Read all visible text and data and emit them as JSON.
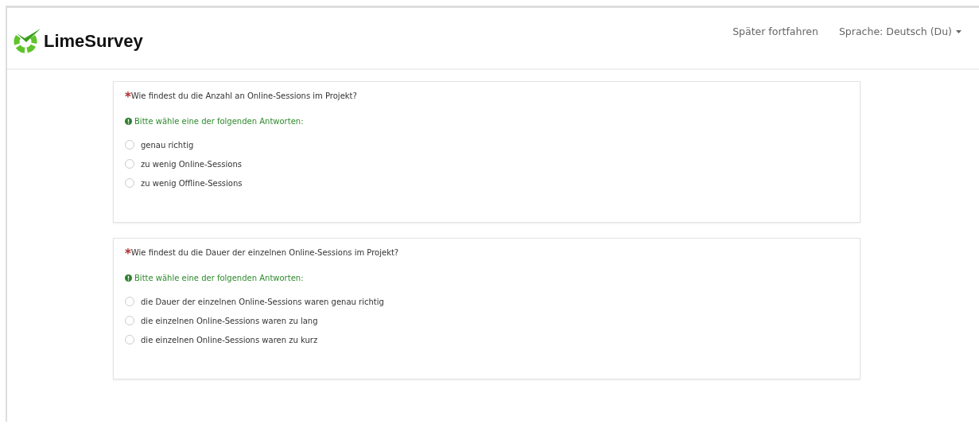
{
  "header": {
    "logo_text": "LimeSurvey",
    "links": [
      {
        "label": "Später fortfahren",
        "dropdown": false
      },
      {
        "label": "Sprache: Deutsch (Du)",
        "dropdown": true
      }
    ]
  },
  "questions": [
    {
      "mandatory_mark": "*",
      "text": "Wie findest du die Anzahl an Online-Sessions im Projekt?",
      "hint": "Bitte wähle eine der folgenden Antworten:",
      "options": [
        {
          "label": "genau richtig",
          "selected": false
        },
        {
          "label": "zu wenig Online-Sessions",
          "selected": false
        },
        {
          "label": "zu wenig Offline-Sessions",
          "selected": false
        }
      ]
    },
    {
      "mandatory_mark": "*",
      "text": "Wie findest du die Dauer der einzelnen Online-Sessions im Projekt?",
      "hint": "Bitte wähle eine der folgenden Antworten:",
      "options": [
        {
          "label": "die Dauer der einzelnen Online-Sessions waren genau richtig",
          "selected": false
        },
        {
          "label": "die einzelnen Online-Sessions waren zu lang",
          "selected": false
        },
        {
          "label": "die einzelnen Online-Sessions waren zu kurz",
          "selected": false
        }
      ]
    }
  ]
}
